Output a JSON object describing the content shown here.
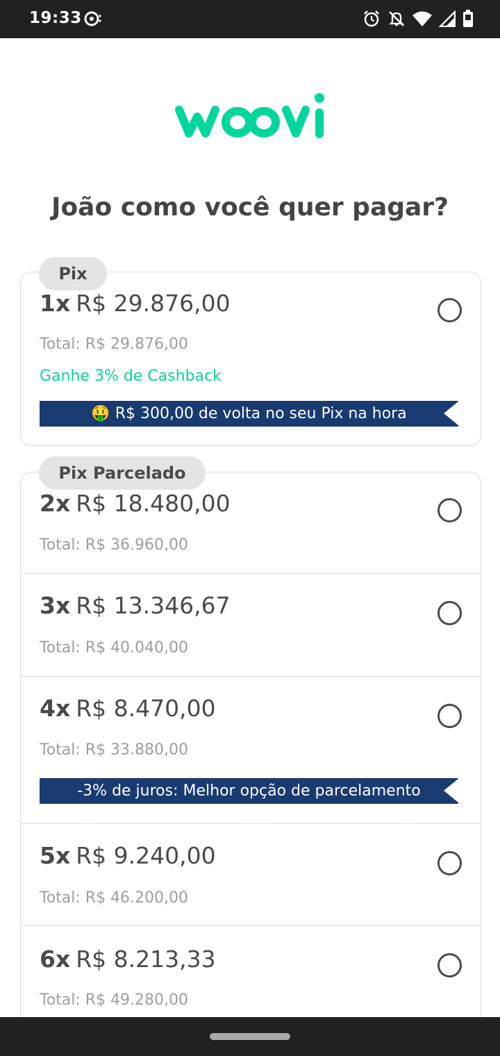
{
  "status_bar": {
    "time": "19:33",
    "icons": [
      "data-saver-icon",
      "alarm-icon",
      "notifications-off-icon",
      "wifi-icon",
      "signal-icon",
      "battery-icon"
    ]
  },
  "brand": {
    "name": "woovi",
    "color": "#03d69d"
  },
  "title": "João como você quer pagar?",
  "pix_section": {
    "label": "Pix",
    "option": {
      "count": "1x",
      "amount": "R$ 29.876,00",
      "total": "Total: R$ 29.876,00",
      "cashback": "Ganhe 3% de Cashback",
      "banner_emoji": "🤑",
      "banner_text": "R$ 300,00 de volta no seu Pix na hora"
    }
  },
  "parcelado_section": {
    "label": "Pix Parcelado",
    "options": [
      {
        "count": "2x",
        "amount": "R$ 18.480,00",
        "total": "Total: R$ 36.960,00"
      },
      {
        "count": "3x",
        "amount": "R$ 13.346,67",
        "total": "Total: R$ 40.040,00"
      },
      {
        "count": "4x",
        "amount": "R$ 8.470,00",
        "total": "Total: R$ 33.880,00",
        "banner_text": "-3% de juros: Melhor opção de parcelamento"
      },
      {
        "count": "5x",
        "amount": "R$ 9.240,00",
        "total": "Total: R$ 46.200,00"
      },
      {
        "count": "6x",
        "amount": "R$ 8.213,33",
        "total": "Total: R$ 49.280,00"
      }
    ]
  },
  "colors": {
    "accent": "#03d69d",
    "banner": "#1a3a72",
    "text": "#4a4a4a",
    "muted": "#9e9e9e",
    "pill": "#e4e4e4"
  }
}
